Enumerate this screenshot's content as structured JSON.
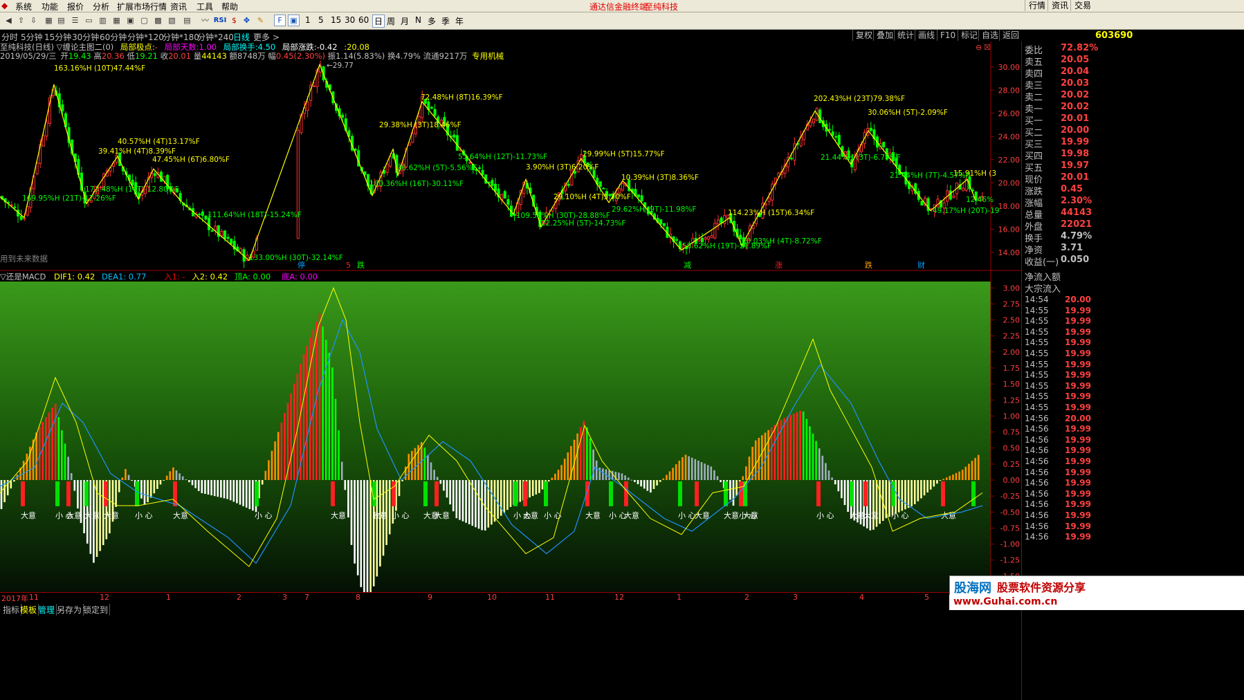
{
  "menu": {
    "items": [
      "系统",
      "功能",
      "报价",
      "分析",
      "扩展市场行情",
      "资讯",
      "工具",
      "帮助"
    ],
    "center_title": "通达信金融终端",
    "center_company": "至纯科技",
    "right_items": [
      "行情",
      "资讯",
      "交易"
    ]
  },
  "toolbar": {
    "number_buttons": [
      "1",
      "5",
      "15",
      "30",
      "60"
    ],
    "period_buttons": [
      "日",
      "周",
      "月",
      "N",
      "多",
      "季",
      "年"
    ],
    "period_active": "日"
  },
  "period_tabs": {
    "items": [
      "分时",
      "5分钟",
      "15分钟",
      "30分钟",
      "60分钟",
      "分钟*120",
      "分钟*180",
      "分钟*240",
      "日线",
      "更多 >"
    ],
    "active": "日线"
  },
  "chart_buttons": [
    "复权",
    "叠加",
    "统计",
    "画线",
    "F10",
    "标记",
    "自选",
    "返回"
  ],
  "stock": {
    "code": "603690",
    "title": "至纯科技(日线) ▽缠论主图二(0)",
    "indicators": [
      {
        "label": "局部极点:",
        "value": "-",
        "color": "#ffff00"
      },
      {
        "label": "局部天数:",
        "value": "1.00",
        "color": "#ff00ff"
      },
      {
        "label": "局部换手:",
        "value": "4.50",
        "color": "#00ffff"
      },
      {
        "label": "局部涨跌:",
        "value": "-0.42",
        "color": "#ffffff"
      },
      {
        "label": ":",
        "value": "20.08",
        "color": "#ffff00"
      }
    ],
    "quote_line": {
      "date": "2019/05/29/三",
      "open_label": "开",
      "open": "19.43",
      "high_label": "高",
      "high": "20.36",
      "low_label": "低",
      "low": "19.21",
      "close_label": "收",
      "close": "20.01",
      "vol_label": "量",
      "vol": "44143",
      "amt_label": "额",
      "amt": "8748万",
      "chg_label": "幅",
      "chg": "0.45(2.30%)",
      "amp_label": "振",
      "amp": "1.14(5.83%)",
      "turn_label": "换",
      "turn": "4.79%",
      "float_label": "流通",
      "float": "9217万",
      "tag": "专用机械"
    },
    "future_note": "用到未来数据"
  },
  "price_axis": [
    "30.00",
    "28.00",
    "26.00",
    "24.00",
    "22.00",
    "20.00",
    "18.00",
    "16.00",
    "14.00"
  ],
  "price_labels_yellow": [
    "163.16%H (10T)47.44%F",
    "40.57%H (4T)13.17%F",
    "39.41%H (4T)8.39%F",
    "47.45%H (6T)6.80%F",
    "72.48%H (8T)16.39%F",
    "29.38%H (3T)18.46%F",
    "3.90%H (3T)6.20%F",
    "29.99%H (5T)15.77%F",
    "29.10%H (4T)5.70%F",
    "10.39%H (3T)8.36%F",
    "114.23%H (15T)6.34%F",
    "202.43%H (23T)79.38%F",
    "30.06%H (5T)-2.09%F",
    "15.91%H (3"
  ],
  "price_labels_green": [
    "169.95%H (21T)-17.26%F",
    "173.48%H (10T)-12.80%F",
    "111.64%H (18T)-15.24%F",
    "133.00%H (30T)-32.14%F",
    "180.36%H (16T)-30.11%F",
    "36.62%H (5T)-5.56%F",
    "55.64%H (12T)-11.73%F",
    "109.59%H (30T)-28.88%F",
    "22.25%H (5T)-14.73%F",
    "29.62%H (9T)-11.98%F",
    "58.62%H (19T)-21.89%F",
    "20.03%H (4T)-8.72%F",
    "21.44%H (3T)-6.79%F",
    "21.44%H (7T)-4.57%F",
    "49.17%H (20T)-19",
    "12.46%"
  ],
  "price_top_label": "29.77",
  "events": [
    "停",
    "5",
    "跌",
    "减",
    "涨",
    "跌",
    "财"
  ],
  "macd": {
    "title": "▽还是MACD",
    "dif": "DIF1: 0.42",
    "dea": "DEA1: 0.77",
    "in1": "入1: -",
    "in2": "入2: 0.42",
    "topA": "顶A: 0.00",
    "botA": "底A: 0.00",
    "axis": [
      "3.00",
      "2.75",
      "2.50",
      "2.25",
      "2.00",
      "1.75",
      "1.50",
      "1.25",
      "1.00",
      "0.75",
      "0.50",
      "0.25",
      "0.00",
      "-0.25",
      "-0.50",
      "-0.75",
      "-1.00",
      "-1.25",
      "-1.50"
    ],
    "signal_texts": [
      "大意",
      "小 心",
      "大意",
      "大意",
      "大意",
      "小 心",
      "大意",
      "小 心",
      "大意",
      "收意",
      "小 心",
      "大意",
      "大意",
      "小 心",
      "大意",
      "小 心",
      "大意",
      "小 心",
      "大意",
      "小 心",
      "大意",
      "大意",
      "小 心",
      "大意",
      "小 心",
      "大意",
      "大意",
      "小 心",
      "大意"
    ]
  },
  "dates": [
    "2017年",
    "11",
    "12",
    "1",
    "2",
    "3",
    "7",
    "8",
    "9",
    "10",
    "11",
    "12",
    "1",
    "2",
    "3",
    "4",
    "5"
  ],
  "bottom_tabs": [
    "指标",
    "模板",
    "管理",
    "另存为",
    "锁定到"
  ],
  "right_panel": {
    "rows": [
      {
        "label": "委比",
        "value": "72.82%"
      },
      {
        "label": "卖五",
        "value": "20.05"
      },
      {
        "label": "卖四",
        "value": "20.04"
      },
      {
        "label": "卖三",
        "value": "20.03"
      },
      {
        "label": "卖二",
        "value": "20.02"
      },
      {
        "label": "卖一",
        "value": "20.02"
      },
      {
        "label": "买一",
        "value": "20.01"
      },
      {
        "label": "买二",
        "value": "20.00"
      },
      {
        "label": "买三",
        "value": "19.99"
      },
      {
        "label": "买四",
        "value": "19.98"
      },
      {
        "label": "买五",
        "value": "19.97"
      },
      {
        "label": "现价",
        "value": "20.01"
      },
      {
        "label": "涨跌",
        "value": "0.45"
      },
      {
        "label": "涨幅",
        "value": "2.30%"
      },
      {
        "label": "总量",
        "value": "44143"
      },
      {
        "label": "外盘",
        "value": "22021"
      },
      {
        "label": "换手",
        "value": "4.79%"
      },
      {
        "label": "净资",
        "value": "3.71"
      },
      {
        "label": "收益(一)",
        "value": "0.050"
      }
    ],
    "flow_labels": [
      "净流入额",
      "大宗流入"
    ],
    "ticks": [
      {
        "t": "14:54",
        "p": "20.00"
      },
      {
        "t": "14:55",
        "p": "19.99"
      },
      {
        "t": "14:55",
        "p": "19.99"
      },
      {
        "t": "14:55",
        "p": "19.99"
      },
      {
        "t": "14:55",
        "p": "19.99"
      },
      {
        "t": "14:55",
        "p": "19.99"
      },
      {
        "t": "14:55",
        "p": "19.99"
      },
      {
        "t": "14:55",
        "p": "19.99"
      },
      {
        "t": "14:55",
        "p": "19.99"
      },
      {
        "t": "14:55",
        "p": "19.99"
      },
      {
        "t": "14:55",
        "p": "19.99"
      },
      {
        "t": "14:56",
        "p": "20.00"
      },
      {
        "t": "14:56",
        "p": "19.99"
      },
      {
        "t": "14:56",
        "p": "19.99"
      },
      {
        "t": "14:56",
        "p": "19.99"
      },
      {
        "t": "14:56",
        "p": "19.99"
      },
      {
        "t": "14:56",
        "p": "19.99"
      },
      {
        "t": "14:56",
        "p": "19.99"
      },
      {
        "t": "14:56",
        "p": "19.99"
      },
      {
        "t": "14:56",
        "p": "19.99"
      },
      {
        "t": "14:56",
        "p": "19.99"
      },
      {
        "t": "14:56",
        "p": "19.99"
      },
      {
        "t": "14:56",
        "p": "19.99"
      }
    ]
  },
  "watermark": {
    "brand": "股海网",
    "slogan": "股票软件资源分享",
    "url": "www.Guhai.com.cn"
  }
}
